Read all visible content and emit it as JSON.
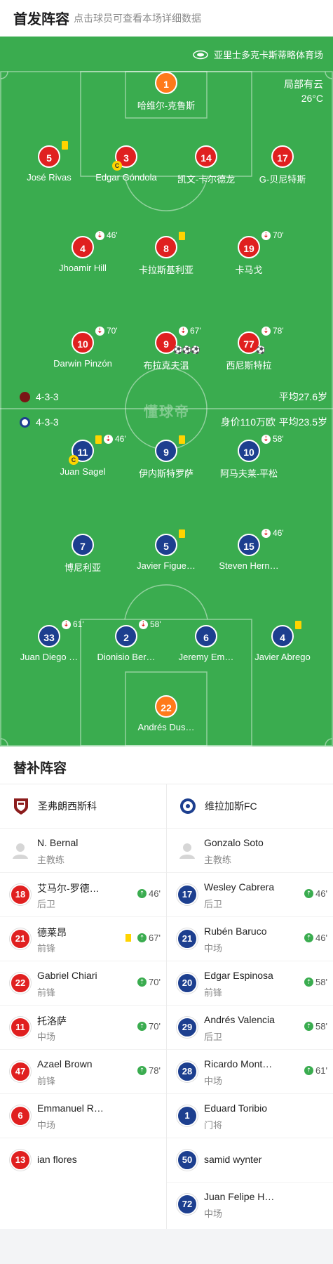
{
  "header": {
    "title": "首发阵容",
    "subtitle": "点击球员可查看本场详细数据"
  },
  "pitch": {
    "stadium": "亚里士多克卡斯蒂略体育场",
    "weather": "局部有云",
    "temperature": "26°C",
    "watermark": "懂球帝",
    "home_bar": {
      "formation": "4-3-3",
      "avg_age": "平均27.6岁"
    },
    "away_bar": {
      "formation": "4-3-3",
      "value": "身价110万欧",
      "avg_age": "平均23.5岁"
    }
  },
  "home_players": [
    {
      "num": "1",
      "name": "哈维尔-克鲁斯",
      "gk": true
    },
    {
      "num": "5",
      "name": "José Rivas",
      "yellow": true
    },
    {
      "num": "3",
      "name": "Edgar Góndola",
      "captain": "C"
    },
    {
      "num": "14",
      "name": "凯文-卡尔德龙"
    },
    {
      "num": "17",
      "name": "G-贝尼特斯"
    },
    {
      "num": "4",
      "name": "Jhoamir Hill",
      "sub_out": "46'"
    },
    {
      "num": "8",
      "name": "卡拉斯基利亚",
      "yellow": true
    },
    {
      "num": "19",
      "name": "卡马戈",
      "sub_out": "70'"
    },
    {
      "num": "10",
      "name": "Darwin Pinzón",
      "sub_out": "70'"
    },
    {
      "num": "9",
      "name": "布拉克夫温",
      "sub_out": "67'",
      "goals": "⚽⚽⚽"
    },
    {
      "num": "77",
      "name": "西尼斯特拉",
      "sub_out": "78'",
      "goals": "⚽"
    }
  ],
  "away_players": [
    {
      "num": "11",
      "name": "Juan Sagel",
      "yellow": true,
      "sub_out": "46'",
      "captain": "C"
    },
    {
      "num": "9",
      "name": "伊内斯特罗萨",
      "yellow": true
    },
    {
      "num": "10",
      "name": "阿马夫莱-平松",
      "sub_out": "58'"
    },
    {
      "num": "7",
      "name": "博尼利亚"
    },
    {
      "num": "5",
      "name": "Javier Figue…",
      "yellow": true
    },
    {
      "num": "15",
      "name": "Steven Hern…",
      "sub_out": "46'"
    },
    {
      "num": "33",
      "name": "Juan Diego …",
      "sub_out": "61'"
    },
    {
      "num": "2",
      "name": "Dionisio Ber…",
      "sub_out": "58'"
    },
    {
      "num": "6",
      "name": "Jeremy Em…"
    },
    {
      "num": "4",
      "name": "Javier Abrego",
      "yellow": true
    },
    {
      "num": "22",
      "name": "Andrés Dus…",
      "gk": true
    }
  ],
  "subs": {
    "title": "替补阵容",
    "home": {
      "club": "圣弗朗西斯科",
      "coach": {
        "name": "N. Bernal",
        "role": "主教练"
      },
      "players": [
        {
          "num": "18",
          "name": "艾马尔-罗德…",
          "pos": "后卫",
          "in": "46'"
        },
        {
          "num": "21",
          "name": "德莱昂",
          "pos": "前锋",
          "in": "67'",
          "yellow": true
        },
        {
          "num": "22",
          "name": "Gabriel Chiari",
          "pos": "前锋",
          "in": "70'"
        },
        {
          "num": "11",
          "name": "托洛萨",
          "pos": "中场",
          "in": "70'"
        },
        {
          "num": "47",
          "name": "Azael Brown",
          "pos": "前锋",
          "in": "78'"
        },
        {
          "num": "6",
          "name": "Emmanuel R…",
          "pos": "中场"
        },
        {
          "num": "13",
          "name": "ian flores",
          "pos": ""
        }
      ]
    },
    "away": {
      "club": "维拉加斯FC",
      "coach": {
        "name": "Gonzalo Soto",
        "role": "主教练"
      },
      "players": [
        {
          "num": "17",
          "name": "Wesley Cabrera",
          "pos": "后卫",
          "in": "46'"
        },
        {
          "num": "21",
          "name": "Rubén Baruco",
          "pos": "中场",
          "in": "46'"
        },
        {
          "num": "20",
          "name": "Edgar Espinosa",
          "pos": "前锋",
          "in": "58'"
        },
        {
          "num": "29",
          "name": "Andrés Valencia",
          "pos": "后卫",
          "in": "58'"
        },
        {
          "num": "28",
          "name": "Ricardo Mont…",
          "pos": "中场",
          "in": "61'"
        },
        {
          "num": "1",
          "name": "Eduard Toribio",
          "pos": "门将"
        },
        {
          "num": "50",
          "name": "samid wynter",
          "pos": ""
        },
        {
          "num": "72",
          "name": "Juan Felipe H…",
          "pos": "中场"
        }
      ]
    }
  }
}
